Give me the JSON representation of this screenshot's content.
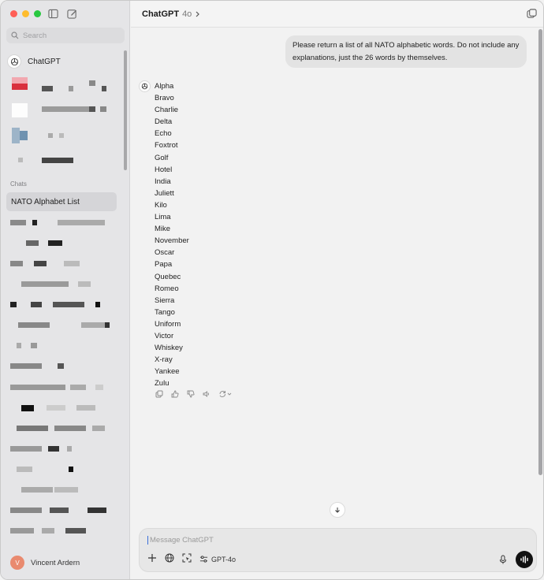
{
  "sidebar": {
    "search_placeholder": "Search",
    "chatgpt_label": "ChatGPT",
    "section_label": "Chats",
    "active_chat": "NATO Alphabet List",
    "user_initial": "V",
    "user_name": "Vincent Ardern"
  },
  "header": {
    "title": "ChatGPT",
    "model": "4o"
  },
  "conversation": {
    "user_message": "Please return a list of all NATO alphabetic words. Do not include any explanations, just the 26 words by themselves.",
    "assistant_words": [
      "Alpha",
      "Bravo",
      "Charlie",
      "Delta",
      "Echo",
      "Foxtrot",
      "Golf",
      "Hotel",
      "India",
      "Juliett",
      "Kilo",
      "Lima",
      "Mike",
      "November",
      "Oscar",
      "Papa",
      "Quebec",
      "Romeo",
      "Sierra",
      "Tango",
      "Uniform",
      "Victor",
      "Whiskey",
      "X-ray",
      "Yankee",
      "Zulu"
    ]
  },
  "composer": {
    "placeholder": "Message ChatGPT",
    "model_chip": "GPT-4o"
  },
  "icons": [
    "sidebar-toggle-icon",
    "compose-icon",
    "search-icon",
    "openai-logo-icon",
    "new-chat-icon",
    "copy-icon",
    "thumbs-up-icon",
    "thumbs-down-icon",
    "speaker-icon",
    "regenerate-icon",
    "arrow-down-icon",
    "plus-icon",
    "globe-icon",
    "cursor-select-icon",
    "sliders-icon",
    "mic-icon",
    "voice-wave-icon"
  ]
}
